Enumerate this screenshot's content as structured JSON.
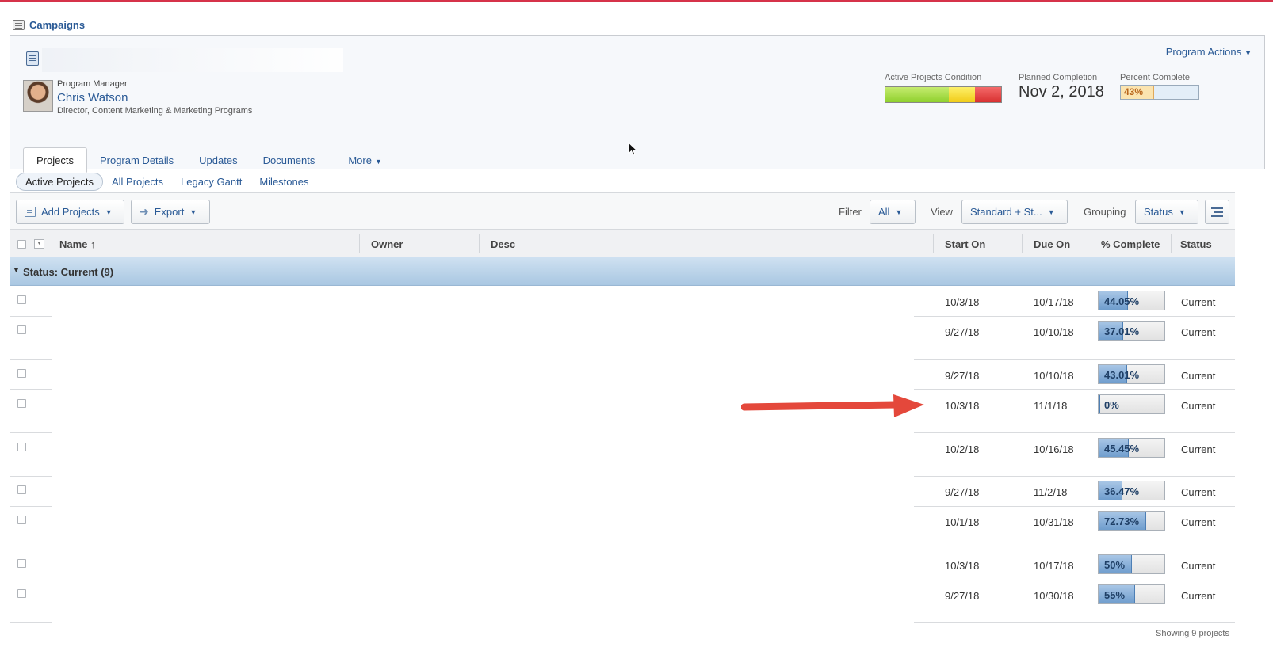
{
  "breadcrumb": {
    "label": "Campaigns"
  },
  "program": {
    "manager_label": "Program Manager",
    "manager_name": "Chris Watson",
    "manager_title": "Director, Content Marketing & Marketing Programs",
    "actions_label": "Program Actions",
    "condition_label": "Active Projects Condition",
    "planned_label": "Planned Completion",
    "planned_value": "Nov 2, 2018",
    "percent_label": "Percent Complete",
    "percent_value": "43%",
    "percent_fraction": 0.43
  },
  "tabs": [
    "Projects",
    "Program Details",
    "Updates",
    "Documents",
    "More"
  ],
  "subtabs": [
    "Active Projects",
    "All Projects",
    "Legacy Gantt",
    "Milestones"
  ],
  "toolbar": {
    "add_projects": "Add Projects",
    "export": "Export",
    "filter_label": "Filter",
    "filter_value": "All",
    "view_label": "View",
    "view_value": "Standard + St...",
    "grouping_label": "Grouping",
    "grouping_value": "Status"
  },
  "columns": {
    "name": "Name ↑",
    "owner": "Owner",
    "desc": "Desc",
    "start": "Start On",
    "due": "Due On",
    "complete": "% Complete",
    "status": "Status"
  },
  "group": {
    "label": "Status: Current (9)"
  },
  "rows": [
    {
      "start": "10/3/18",
      "due": "10/17/18",
      "pct": "44.05%",
      "frac": 0.4405,
      "status": "Current"
    },
    {
      "start": "9/27/18",
      "due": "10/10/18",
      "pct": "37.01%",
      "frac": 0.3701,
      "status": "Current"
    },
    {
      "start": "9/27/18",
      "due": "10/10/18",
      "pct": "43.01%",
      "frac": 0.4301,
      "status": "Current"
    },
    {
      "start": "10/3/18",
      "due": "11/1/18",
      "pct": "0%",
      "frac": 0.0,
      "status": "Current"
    },
    {
      "start": "10/2/18",
      "due": "10/16/18",
      "pct": "45.45%",
      "frac": 0.4545,
      "status": "Current"
    },
    {
      "start": "9/27/18",
      "due": "11/2/18",
      "pct": "36.47%",
      "frac": 0.3647,
      "status": "Current"
    },
    {
      "start": "10/1/18",
      "due": "10/31/18",
      "pct": "72.73%",
      "frac": 0.7273,
      "status": "Current"
    },
    {
      "start": "10/3/18",
      "due": "10/17/18",
      "pct": "50%",
      "frac": 0.5,
      "status": "Current"
    },
    {
      "start": "9/27/18",
      "due": "10/30/18",
      "pct": "55%",
      "frac": 0.55,
      "status": "Current"
    }
  ],
  "footer": {
    "label": "Showing 9 projects"
  }
}
